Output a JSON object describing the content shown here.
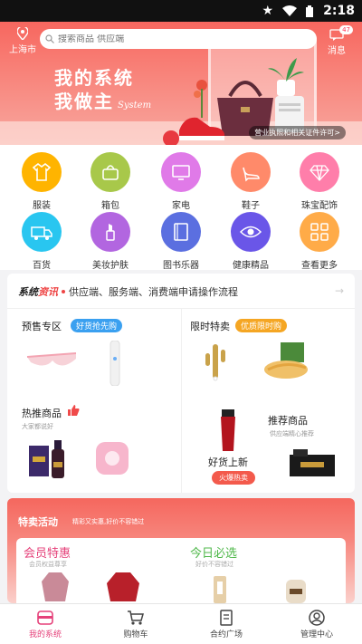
{
  "status_bar": {
    "time": "2:18"
  },
  "header": {
    "location": "上海市",
    "search_placeholder": "搜索商品 供应端",
    "message_label": "消息",
    "message_count": "47"
  },
  "banner": {
    "slogan_line1": "我的系统",
    "slogan_line2": "我做主",
    "slogan_script": "System",
    "license_button": "营业执照和相关证件许可>"
  },
  "categories": [
    {
      "label": "服装",
      "icon": "clothing-icon",
      "color": "#ffb400"
    },
    {
      "label": "箱包",
      "icon": "bag-icon",
      "color": "#a8c84a"
    },
    {
      "label": "家电",
      "icon": "monitor-icon",
      "color": "#e07ae8"
    },
    {
      "label": "鞋子",
      "icon": "heel-shoe-icon",
      "color": "#ff8a6a"
    },
    {
      "label": "珠宝配饰",
      "icon": "diamond-icon",
      "color": "#ff7eaa"
    },
    {
      "label": "百货",
      "icon": "truck-icon",
      "color": "#29c6f0"
    },
    {
      "label": "美妆护肤",
      "icon": "lipstick-icon",
      "color": "#b266e0"
    },
    {
      "label": "图书乐器",
      "icon": "book-icon",
      "color": "#5b6fe0"
    },
    {
      "label": "健康精品",
      "icon": "eye-icon",
      "color": "#6a56e8"
    },
    {
      "label": "查看更多",
      "icon": "grid-icon",
      "color": "#ffab48"
    }
  ],
  "news": {
    "brand": "系统",
    "brand_highlight": "资讯",
    "text": "供应端、服务端、消费端申请操作流程"
  },
  "blocks": {
    "presale": {
      "title": "预售专区",
      "tag": "好货抢先购",
      "tag_color": "#3aa0f0"
    },
    "flash": {
      "title": "限时特卖",
      "tag": "优质限时购",
      "tag_color": "#f5a623"
    },
    "hot": {
      "title": "热推商品",
      "subtitle": "大家都说好"
    },
    "new": {
      "title": "好货上新",
      "button": "火爆热卖"
    },
    "recommend": {
      "title": "推荐商品",
      "subtitle": "供应端精心推荐"
    }
  },
  "promo": {
    "title": "特卖活动",
    "subtitle": "精彩又实惠,好价不容错过",
    "member_title": "会员特惠",
    "member_sub": "会员权益尊享",
    "today_title": "今日必选",
    "today_sub": "好价不容错过"
  },
  "tabs": [
    {
      "label": "我的系统",
      "icon": "home-box-icon",
      "active": true
    },
    {
      "label": "购物车",
      "icon": "cart-icon",
      "active": false
    },
    {
      "label": "合约广场",
      "icon": "contract-icon",
      "active": false
    },
    {
      "label": "管理中心",
      "icon": "user-icon",
      "active": false
    }
  ]
}
